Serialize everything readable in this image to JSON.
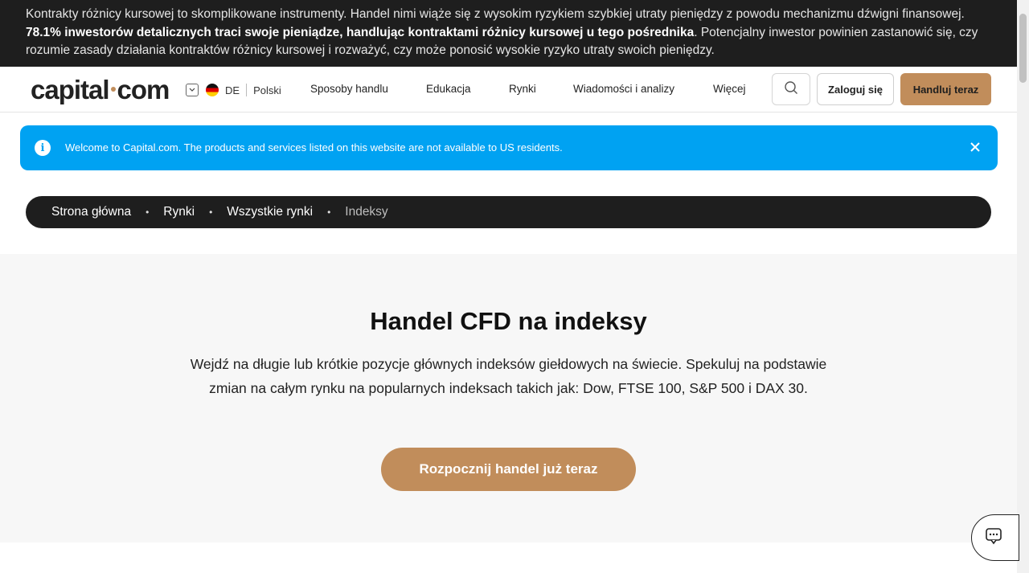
{
  "risk_warning": {
    "part1": "Kontrakty różnicy kursowej to skomplikowane instrumenty. Handel nimi wiąże się z wysokim ryzykiem szybkiej utraty pieniędzy z powodu mechanizmu dźwigni finansowej. ",
    "bold": "78.1% inwestorów detalicznych traci swoje pieniądze, handlując kontraktami różnicy kursowej u tego pośrednika",
    "part2": ". Potencjalny inwestor powinien zastanowić się, czy rozumie zasady działania kontraktów różnicy kursowej i rozważyć, czy może ponosić wysokie ryzyko utraty swoich pieniędzy."
  },
  "header": {
    "logo_left": "capital",
    "logo_right": "com",
    "region_code": "DE",
    "language": "Polski",
    "nav": [
      "Sposoby handlu",
      "Edukacja",
      "Rynki",
      "Wiadomości i analizy",
      "Więcej"
    ],
    "login_label": "Zaloguj się",
    "trade_label": "Handluj teraz"
  },
  "notice": {
    "message": "Welcome to Capital.com. The products and services listed on this website are not available to US residents.",
    "icon": "info-icon",
    "close_icon": "close-icon"
  },
  "breadcrumb": [
    "Strona główna",
    "Rynki",
    "Wszystkie rynki",
    "Indeksy"
  ],
  "hero": {
    "title": "Handel CFD na indeksy",
    "description": "Wejdź na długie lub krótkie pozycje głównych indeksów giełdowych na świecie. Spekuluj na podstawie zmian na całym rynku na popularnych indeksach takich jak: Dow, FTSE 100, S&P 500 i DAX 30.",
    "cta_label": "Rozpocznij handel już teraz"
  },
  "colors": {
    "brand_accent": "#c18d5b",
    "notice_blue": "#00a2f2",
    "dark": "#1e1e1e"
  }
}
